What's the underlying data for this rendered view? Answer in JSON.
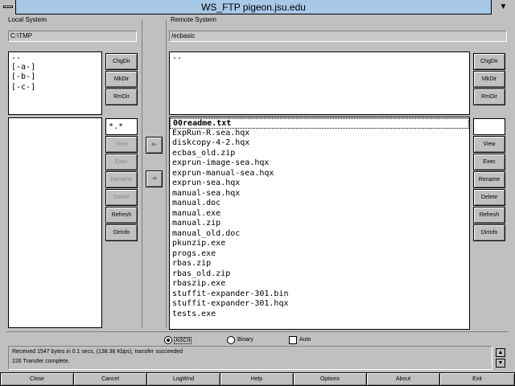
{
  "window": {
    "title": "WS_FTP pigeon.jsu.edu",
    "minimize_glyph": "▼"
  },
  "local": {
    "label": "Local System",
    "path": "C:\\TMP",
    "dirs": [
      "..",
      "[-a-]",
      "[-b-]",
      "[-c-]"
    ],
    "dir_buttons": [
      "ChgDir",
      "MkDir",
      "RmDir"
    ],
    "file_mask": "*.*",
    "file_buttons": [
      "View",
      "Exec",
      "Rename",
      "Delete",
      "Refresh",
      "DirInfo"
    ]
  },
  "transfer": {
    "to_remote": "->",
    "to_local": "<-"
  },
  "remote": {
    "label": "Remote System",
    "path": "/ecbasic",
    "dirs": [
      ".."
    ],
    "dir_buttons": [
      "ChgDir",
      "MkDir",
      "RmDir"
    ],
    "files": [
      "00readme.txt",
      "ExpRun-R.sea.hqx",
      "diskcopy-4-2.hqx",
      "ecbas_old.zip",
      "exprun-image-sea.hqx",
      "exprun-manual-sea.hqx",
      "exprun-sea.hqx",
      "manual-sea.hqx",
      "manual.doc",
      "manual.exe",
      "manual.zip",
      "manual_old.doc",
      "pkunzip.exe",
      "progs.exe",
      "rbas.zip",
      "rbas_old.zip",
      "rbaszip.exe",
      "stuffit-expander-301.bin",
      "stuffit-expander-301.hqx",
      "tests.exe"
    ],
    "file_buttons": [
      "View",
      "Exec",
      "Rename",
      "Delete",
      "Refresh",
      "DirInfo"
    ]
  },
  "mode": {
    "ascii": "ASCII",
    "binary": "Binary",
    "auto": "Auto"
  },
  "status": {
    "line1": "Received 1547 bytes in 0.1 secs, (138.36 Kbps), transfer succeeded",
    "line2": "226 Transfer complete.",
    "up_glyph": "▲",
    "down_glyph": "▼"
  },
  "bottom_buttons": [
    "Close",
    "Cancel",
    "LogWnd",
    "Help",
    "Options",
    "About",
    "Exit"
  ]
}
